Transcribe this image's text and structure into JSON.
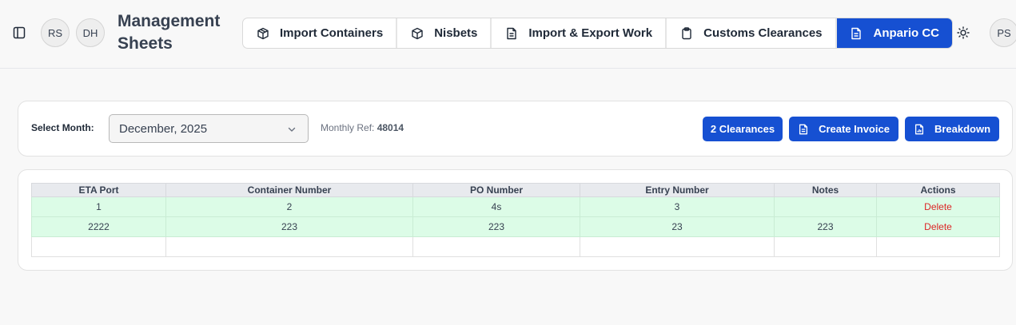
{
  "header": {
    "title": "Management Sheets",
    "avatars": [
      "RS",
      "DH"
    ],
    "user_avatar": "PS",
    "tabs": [
      {
        "label": "Import Containers",
        "icon": "box-icon",
        "active": false
      },
      {
        "label": "Nisbets",
        "icon": "package-icon",
        "active": false
      },
      {
        "label": "Import & Export Work",
        "icon": "document-icon",
        "active": false
      },
      {
        "label": "Customs Clearances",
        "icon": "clipboard-icon",
        "active": false
      },
      {
        "label": "Anpario CC",
        "icon": "document-icon",
        "active": true
      }
    ]
  },
  "filter": {
    "label": "Select Month:",
    "month_value": "December, 2025",
    "monthly_ref_label": "Monthly Ref:",
    "monthly_ref_value": "48014",
    "clearances_label": "2 Clearances",
    "create_invoice_label": "Create Invoice",
    "breakdown_label": "Breakdown"
  },
  "table": {
    "columns": [
      "ETA Port",
      "Container Number",
      "PO Number",
      "Entry Number",
      "Notes",
      "Actions"
    ],
    "rows": [
      {
        "eta_port": "1",
        "container_number": "2",
        "po_number": "4s",
        "entry_number": "3",
        "notes": "",
        "action": "Delete"
      },
      {
        "eta_port": "2222",
        "container_number": "223",
        "po_number": "223",
        "entry_number": "23",
        "notes": "223",
        "action": "Delete"
      }
    ]
  },
  "colors": {
    "accent": "#1650d2",
    "row_fill": "#dcfce7",
    "delete": "#dc2626"
  }
}
